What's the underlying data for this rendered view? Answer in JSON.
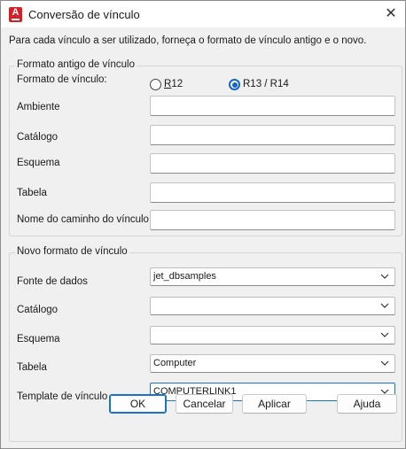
{
  "window": {
    "title": "Conversão de vínculo",
    "close_glyph": "✕",
    "app_icon_letter": "A",
    "app_icon_color": "#d61f26"
  },
  "instruction": "Para cada vínculo a ser utilizado, forneça o formato de vínculo antigo e o novo.",
  "old_format": {
    "group_title": "Formato antigo de vínculo",
    "format_label": "Formato de vínculo:",
    "radio_r12": {
      "label": "R12",
      "selected": false
    },
    "radio_r13": {
      "label": "R13 / R14",
      "selected": true
    },
    "fields": [
      {
        "label": "Ambiente",
        "value": ""
      },
      {
        "label": "Catálogo",
        "value": ""
      },
      {
        "label": "Esquema",
        "value": ""
      },
      {
        "label": "Tabela",
        "value": ""
      },
      {
        "label": "Nome do caminho do vínculo",
        "value": ""
      }
    ]
  },
  "new_format": {
    "group_title": "Novo formato de vínculo",
    "fields": [
      {
        "label": "Fonte de dados",
        "value": "jet_dbsamples"
      },
      {
        "label": "Catálogo",
        "value": ""
      },
      {
        "label": "Esquema",
        "value": ""
      },
      {
        "label": "Tabela",
        "value": "Computer"
      },
      {
        "label": "Template de vínculo",
        "value": "COMPUTERLINK1"
      }
    ]
  },
  "buttons": {
    "ok": "OK",
    "cancel": "Cancelar",
    "apply": "Aplicar",
    "help": "Ajuda"
  },
  "colors": {
    "accent": "#1a73c7",
    "background": "#f0f0f0"
  }
}
